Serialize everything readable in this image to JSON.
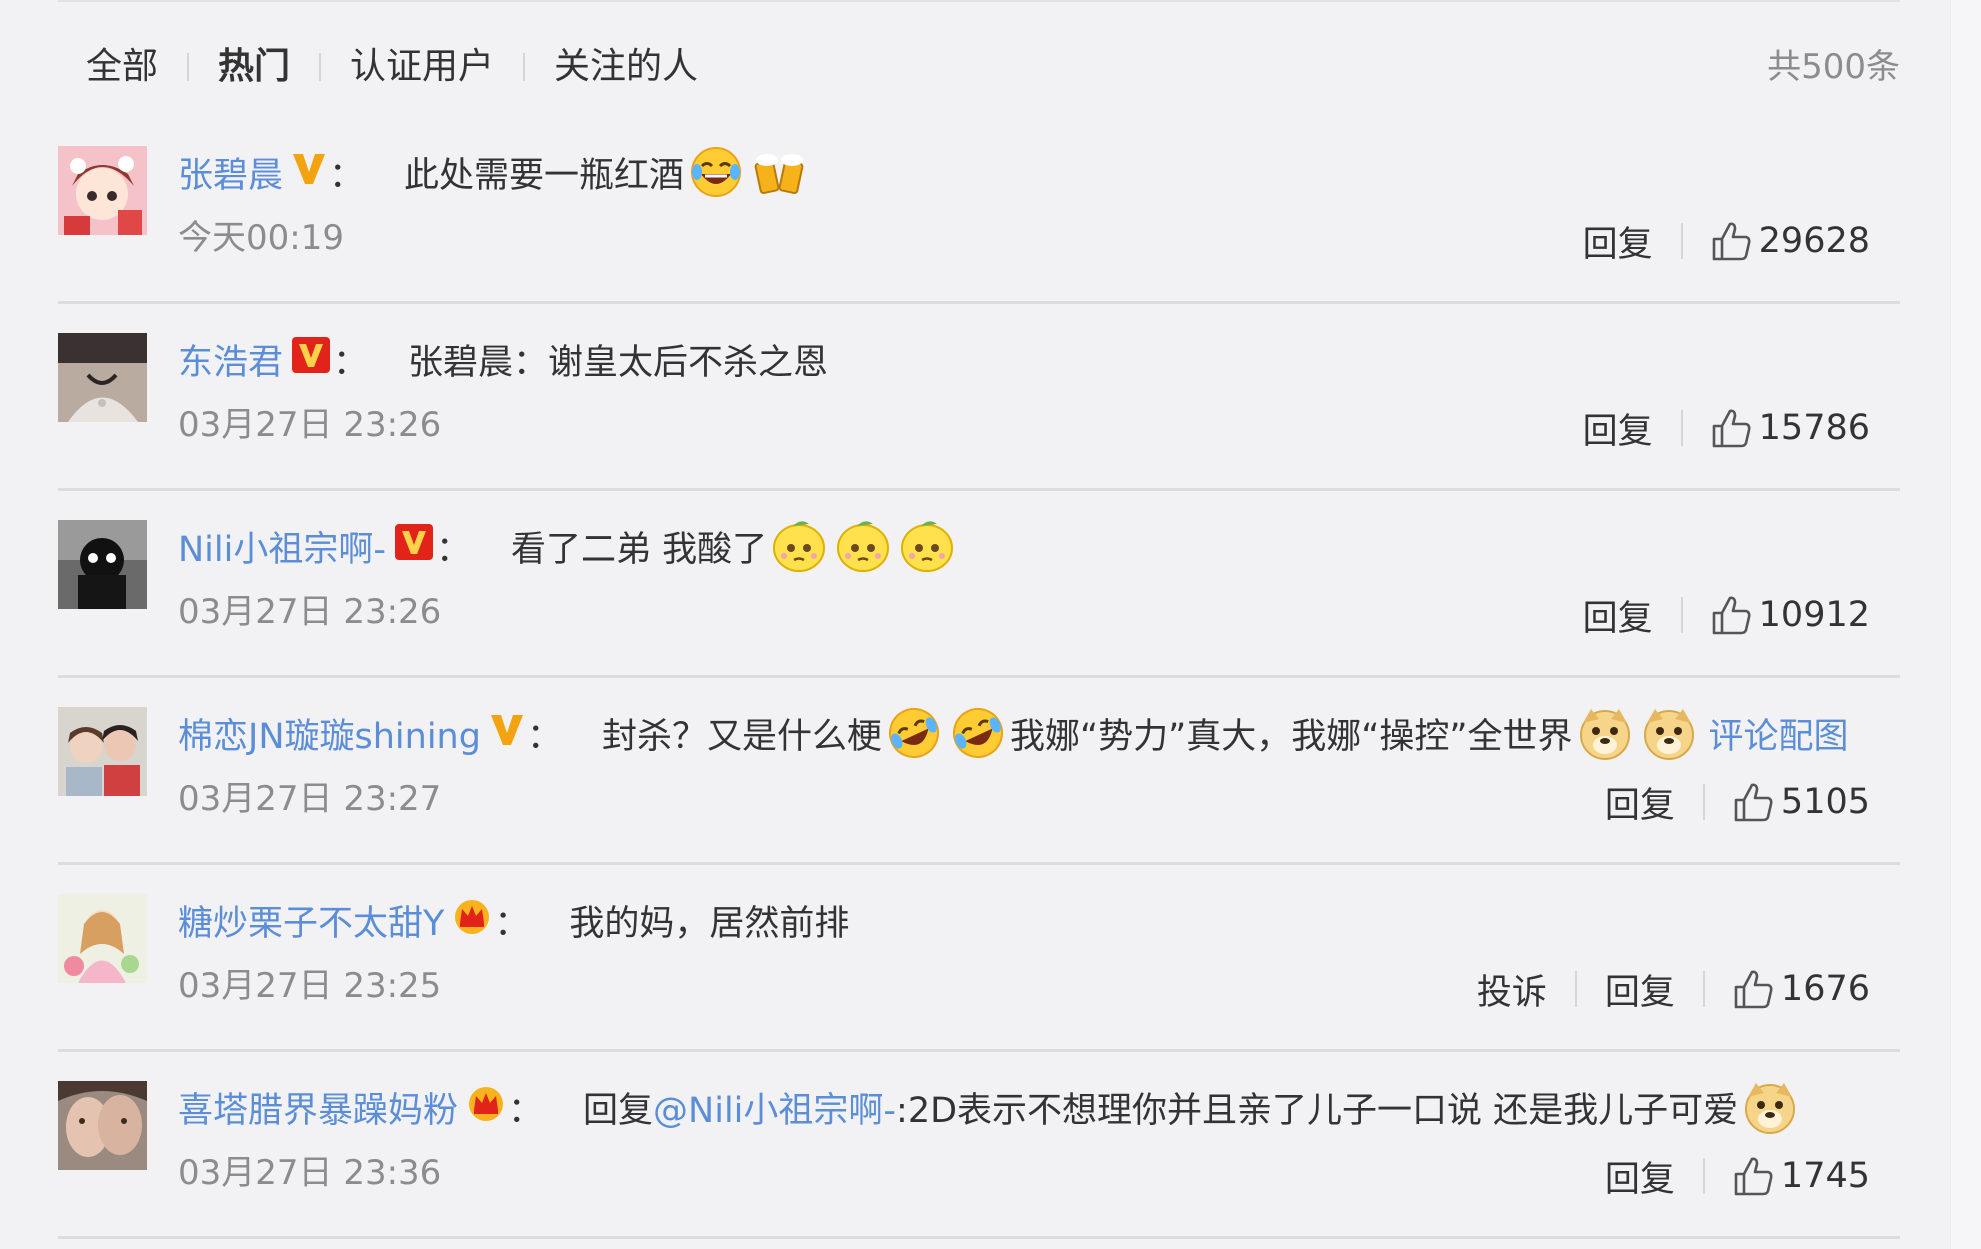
{
  "tabs": [
    "全部",
    "热门",
    "认证用户",
    "关注的人"
  ],
  "active_tab": "热门",
  "total": "共500条",
  "actions": {
    "reply": "回复",
    "report": "投诉"
  },
  "colors": {
    "link": "#5b8ed6",
    "muted": "#8c8c8c",
    "text": "#333333",
    "badge_gold": "#f2a30f",
    "badge_red": "#e2231a"
  },
  "comments": [
    {
      "user": "张碧晨",
      "badge": "gold-v-icon",
      "colon": "：",
      "parts": [
        {
          "text": "此处需要一瓶红酒"
        }
      ],
      "emojis_after": [
        "laughing-tears-emoji-icon",
        "beer-cheers-emoji-icon"
      ],
      "time": "今天00:19",
      "likes": "29628",
      "report": false
    },
    {
      "user": "东浩君",
      "badge": "red-v-icon",
      "colon": "：",
      "parts": [
        {
          "text": "张碧晨：谢皇太后不杀之恩"
        }
      ],
      "emojis_after": [],
      "time": "03月27日 23:26",
      "likes": "15786",
      "report": false
    },
    {
      "user": "Nili小祖宗啊-",
      "badge": "red-v-icon",
      "colon": "：",
      "parts": [
        {
          "text": "看了二弟 我酸了"
        }
      ],
      "emojis_after": [
        "lemon-face-emoji-icon",
        "lemon-face-emoji-icon",
        "lemon-face-emoji-icon"
      ],
      "time": "03月27日 23:26",
      "likes": "10912",
      "report": false
    },
    {
      "user": "棉恋JN璇璇shining",
      "badge": "gold-v-icon",
      "colon": "：",
      "parts": [
        {
          "text": "封杀？又是什么梗"
        },
        {
          "emoji": "rolling-laugh-emoji-icon"
        },
        {
          "emoji": "rolling-laugh-emoji-icon"
        },
        {
          "text": "我娜“势力”真大，我娜“操控”全世界"
        },
        {
          "emoji": "doge-emoji-icon"
        },
        {
          "emoji": "doge-emoji-icon"
        },
        {
          "link": "评论配图"
        }
      ],
      "emojis_after": [],
      "time": "03月27日 23:27",
      "likes": "5105",
      "report": false
    },
    {
      "user": "糖炒栗子不太甜Y",
      "badge": "crown-icon",
      "colon": "：",
      "parts": [
        {
          "text": "我的妈，居然前排"
        }
      ],
      "emojis_after": [],
      "time": "03月27日 23:25",
      "likes": "1676",
      "report": true
    },
    {
      "user": "喜塔腊界暴躁妈粉",
      "badge": "crown-icon",
      "colon": "：",
      "parts": [
        {
          "text": "回复"
        },
        {
          "link": "@Nili小祖宗啊-"
        },
        {
          "text": ":2D表示不想理你并且亲了儿子一口说 还是我儿子可爱"
        },
        {
          "emoji": "doge-emoji-icon"
        }
      ],
      "emojis_after": [],
      "time": "03月27日 23:36",
      "likes": "1745",
      "report": false
    }
  ]
}
